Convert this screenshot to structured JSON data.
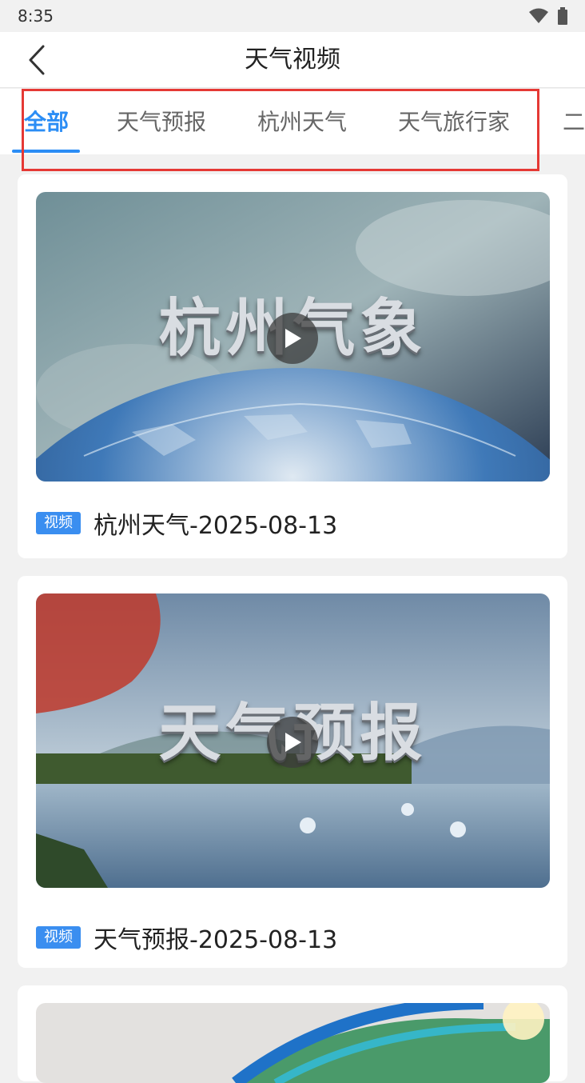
{
  "status": {
    "time": "8:35"
  },
  "header": {
    "title": "天气视频"
  },
  "tabs": [
    {
      "label": "全部",
      "active": true
    },
    {
      "label": "天气预报",
      "active": false
    },
    {
      "label": "杭州天气",
      "active": false
    },
    {
      "label": "天气旅行家",
      "active": false
    },
    {
      "label": "二",
      "active": false
    }
  ],
  "videos": [
    {
      "badge": "视频",
      "title": "杭州天气-2025-08-13",
      "overlay": "杭州气象"
    },
    {
      "badge": "视频",
      "title": "天气预报-2025-08-13",
      "overlay": "天气预报"
    }
  ],
  "colors": {
    "accent": "#2b8df5",
    "annotation": "#e53935",
    "badge": "#3a8ef0"
  }
}
